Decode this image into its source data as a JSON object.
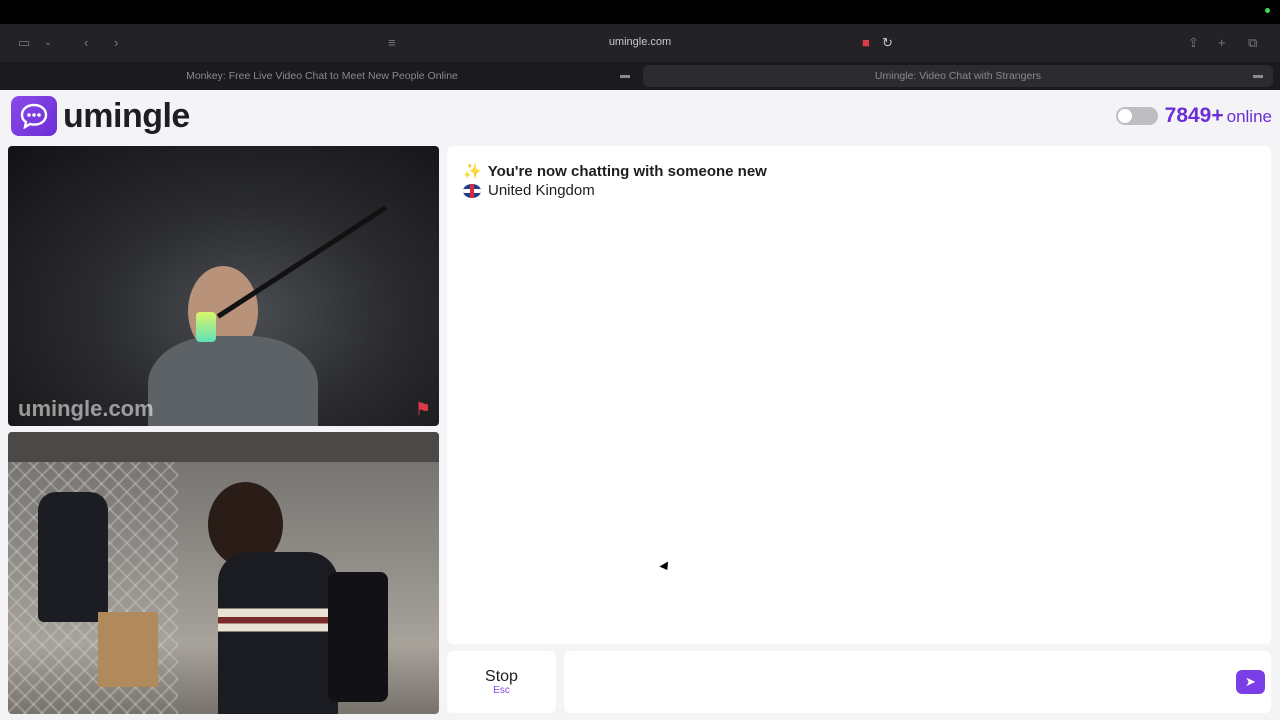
{
  "browser": {
    "url": "umingle.com",
    "tabs": [
      {
        "title": "Monkey: Free Live Video Chat to Meet New People Online",
        "active": false
      },
      {
        "title": "Umingle: Video Chat with Strangers",
        "active": true
      }
    ],
    "icons": [
      "sidebar-icon",
      "chevron-down-icon",
      "back-icon",
      "forward-icon",
      "reader-icon",
      "camera-recording-icon",
      "reload-icon",
      "share-icon",
      "new-tab-icon",
      "tab-overview-icon"
    ]
  },
  "header": {
    "brand": "umingle",
    "online_count": "7849+",
    "online_label": "online"
  },
  "videos": {
    "watermark": "umingle.com"
  },
  "chat": {
    "status": "You're now chatting with someone new",
    "country": "United Kingdom"
  },
  "controls": {
    "stop_label": "Stop",
    "stop_shortcut": "Esc",
    "message_value": ""
  },
  "colors": {
    "accent": "#6b2fd6",
    "page_bg": "#f4f3f6"
  }
}
